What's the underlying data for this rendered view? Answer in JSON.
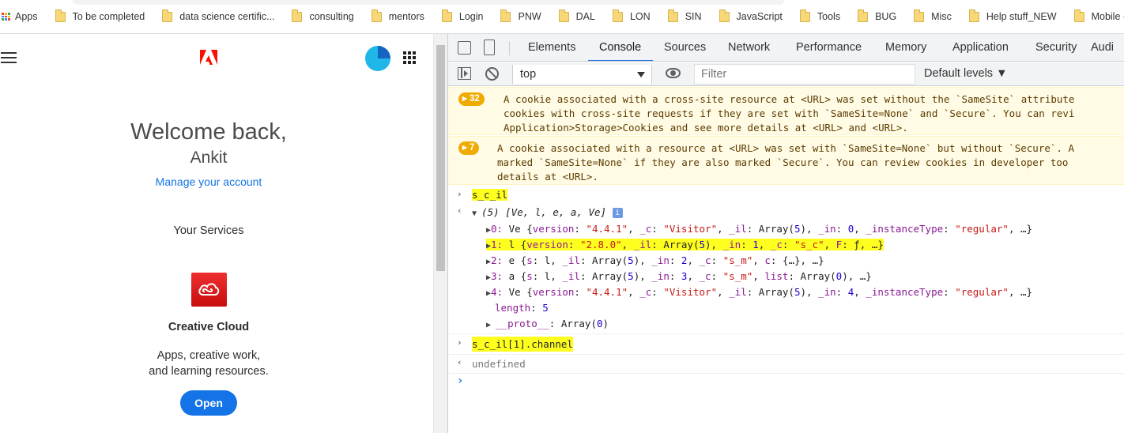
{
  "bookmarks": [
    {
      "label": "Apps",
      "type": "apps"
    },
    {
      "label": "To be completed",
      "type": "folder"
    },
    {
      "label": "data science certific...",
      "type": "folder"
    },
    {
      "label": "consulting",
      "type": "folder"
    },
    {
      "label": "mentors",
      "type": "folder"
    },
    {
      "label": "Login",
      "type": "folder"
    },
    {
      "label": "PNW",
      "type": "folder"
    },
    {
      "label": "DAL",
      "type": "folder"
    },
    {
      "label": "LON",
      "type": "folder"
    },
    {
      "label": "SIN",
      "type": "folder"
    },
    {
      "label": "JavaScript",
      "type": "folder"
    },
    {
      "label": "Tools",
      "type": "folder"
    },
    {
      "label": "BUG",
      "type": "folder"
    },
    {
      "label": "Misc",
      "type": "folder"
    },
    {
      "label": "Help stuff_NEW",
      "type": "folder"
    },
    {
      "label": "Mobile - Important",
      "type": "folder"
    }
  ],
  "adobe": {
    "welcome": "Welcome back,",
    "user_name": "Ankit",
    "manage_link": "Manage your account",
    "services_heading": "Your Services",
    "service_title": "Creative Cloud",
    "service_desc_line1": "Apps, creative work,",
    "service_desc_line2": "and learning resources.",
    "open_button": "Open",
    "brand_color": "#fa0f00",
    "accent_color": "#1473e6"
  },
  "devtools": {
    "tabs": [
      "Elements",
      "Console",
      "Sources",
      "Network",
      "Performance",
      "Memory",
      "Application",
      "Security",
      "Audi"
    ],
    "active_tab": "Console",
    "context": "top",
    "filter_placeholder": "Filter",
    "levels": "Default levels ▼",
    "warnings": [
      {
        "count": "32",
        "lines": [
          "A cookie associated with a cross-site resource at <URL> was set without the `SameSite` attribute",
          "cookies with cross-site requests if they are set with `SameSite=None` and `Secure`. You can revi",
          "Application>Storage>Cookies and see more details at <URL> and <URL>."
        ]
      },
      {
        "count": "7",
        "lines": [
          "A cookie associated with a resource at <URL> was set with `SameSite=None` but without `Secure`. A",
          "marked `SameSite=None` if they are also marked `Secure`. You can review cookies in developer too",
          "details at <URL>."
        ]
      }
    ],
    "input1": "s_c_il",
    "result_header": "(5) [Ve, l, e, a, Ve]",
    "items": [
      {
        "idx": "0",
        "text": "Ve {version: \"4.4.1\", _c: \"Visitor\", _il: Array(5), _in: 0, _instanceType: \"regular\", …}",
        "highlight": false
      },
      {
        "idx": "1",
        "text": "l {version: \"2.8.0\", _il: Array(5), _in: 1, _c: \"s_c\", F: ƒ, …}",
        "highlight": true
      },
      {
        "idx": "2",
        "text": "e {s: l, _il: Array(5), _in: 2, _c: \"s_m\", c: {…}, …}",
        "highlight": false
      },
      {
        "idx": "3",
        "text": "a {s: l, _il: Array(5), _in: 3, _c: \"s_m\", list: Array(0), …}",
        "highlight": false
      },
      {
        "idx": "4",
        "text": "Ve {version: \"4.4.1\", _c: \"Visitor\", _il: Array(5), _in: 4, _instanceType: \"regular\", …}",
        "highlight": false
      }
    ],
    "length_line": "length: 5",
    "proto_line": "__proto__: Array(0)",
    "input2": "s_c_il[1].channel",
    "output2": "undefined"
  }
}
